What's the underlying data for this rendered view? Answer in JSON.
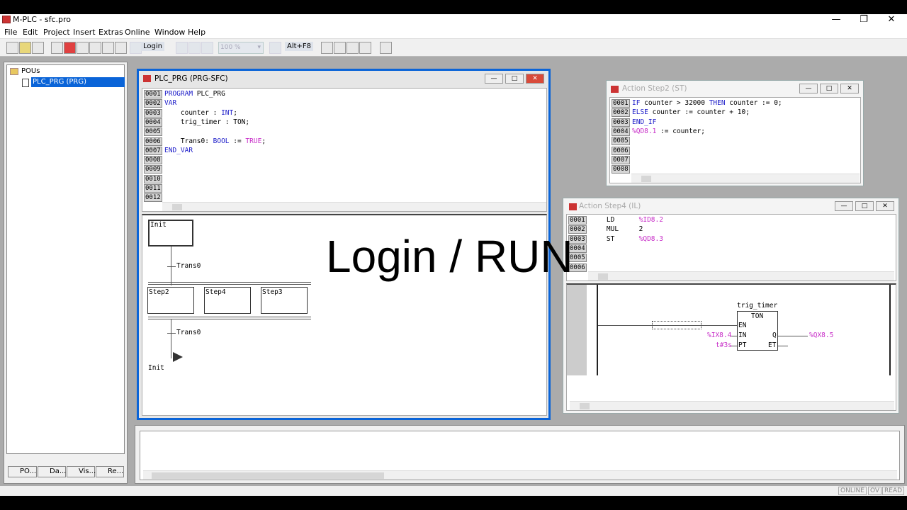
{
  "app": {
    "title": "M-PLC - sfc.pro"
  },
  "menu": [
    "File",
    "Edit",
    "Project",
    "Insert",
    "Extras",
    "Online",
    "Window",
    "Help"
  ],
  "toolbar": {
    "login_label": "Login",
    "zoom": "100 %",
    "shortcut": "Alt+F8"
  },
  "tree": {
    "root": "POUs",
    "item": "PLC_PRG (PRG)"
  },
  "panel_tabs": [
    "PO...",
    "Da...",
    "Vis...",
    "Re..."
  ],
  "plc_window": {
    "title": "PLC_PRG (PRG-SFC)",
    "line_numbers": [
      "0001",
      "0002",
      "0003",
      "0004",
      "0005",
      "0006",
      "0007",
      "0008",
      "0009",
      "0010",
      "0011",
      "0012"
    ],
    "lines": [
      [
        [
          "kw",
          "PROGRAM"
        ],
        [
          "tx",
          " PLC_PRG"
        ]
      ],
      [
        [
          "kw",
          "VAR"
        ]
      ],
      [
        [
          "tx",
          "    counter : "
        ],
        [
          "kw",
          "INT"
        ],
        [
          "tx",
          ";"
        ]
      ],
      [
        [
          "tx",
          "    trig_timer : TON;"
        ]
      ],
      [
        [
          "tx",
          ""
        ]
      ],
      [
        [
          "tx",
          "    Trans0: "
        ],
        [
          "kw",
          "BOOL"
        ],
        [
          "tx",
          " := "
        ],
        [
          "vr",
          "TRUE"
        ],
        [
          "tx",
          ";"
        ]
      ],
      [
        [
          "kw",
          "END_VAR"
        ]
      ]
    ],
    "sfc": {
      "init": "Init",
      "trans_top": "Trans0",
      "steps": [
        "Step2",
        "Step4",
        "Step3"
      ],
      "trans_bottom": "Trans0",
      "jump": "Init"
    }
  },
  "step2_window": {
    "title": "Action Step2 (ST)",
    "line_numbers": [
      "0001",
      "0002",
      "0003",
      "0004",
      "0005",
      "0006",
      "0007",
      "0008"
    ],
    "lines": [
      [
        [
          "kw",
          "IF"
        ],
        [
          "tx",
          " counter > 32000 "
        ],
        [
          "kw",
          "THEN"
        ],
        [
          "tx",
          " counter := 0;"
        ]
      ],
      [
        [
          "kw",
          "ELSE"
        ],
        [
          "tx",
          " counter := counter + 10;"
        ]
      ],
      [
        [
          "kw",
          "END_IF"
        ]
      ],
      [
        [
          "vr",
          "%QD8.1"
        ],
        [
          "tx",
          " := counter;"
        ]
      ]
    ]
  },
  "step4_window": {
    "title": "Action Step4 (IL)",
    "line_numbers": [
      "0001",
      "0002",
      "0003",
      "0004",
      "0005",
      "0006"
    ],
    "lines": [
      [
        [
          "tx",
          "    LD      "
        ],
        [
          "vr",
          "%ID8.2"
        ]
      ],
      [
        [
          "tx",
          "    MUL     2"
        ]
      ],
      [
        [
          "tx",
          "    ST      "
        ],
        [
          "vr",
          "%QD8.3"
        ]
      ]
    ],
    "fbd": {
      "instance": "trig_timer",
      "type": "TON",
      "pin_en": "EN",
      "pin_in": "IN",
      "pin_pt": "PT",
      "pin_q": "Q",
      "pin_et": "ET",
      "in_var": "%IX8.4",
      "pt_var": "t#3s",
      "q_var": "%QX8.5"
    }
  },
  "overlay_text": "Login / RUN",
  "status": [
    "ONLINE",
    "OV",
    "READ"
  ]
}
